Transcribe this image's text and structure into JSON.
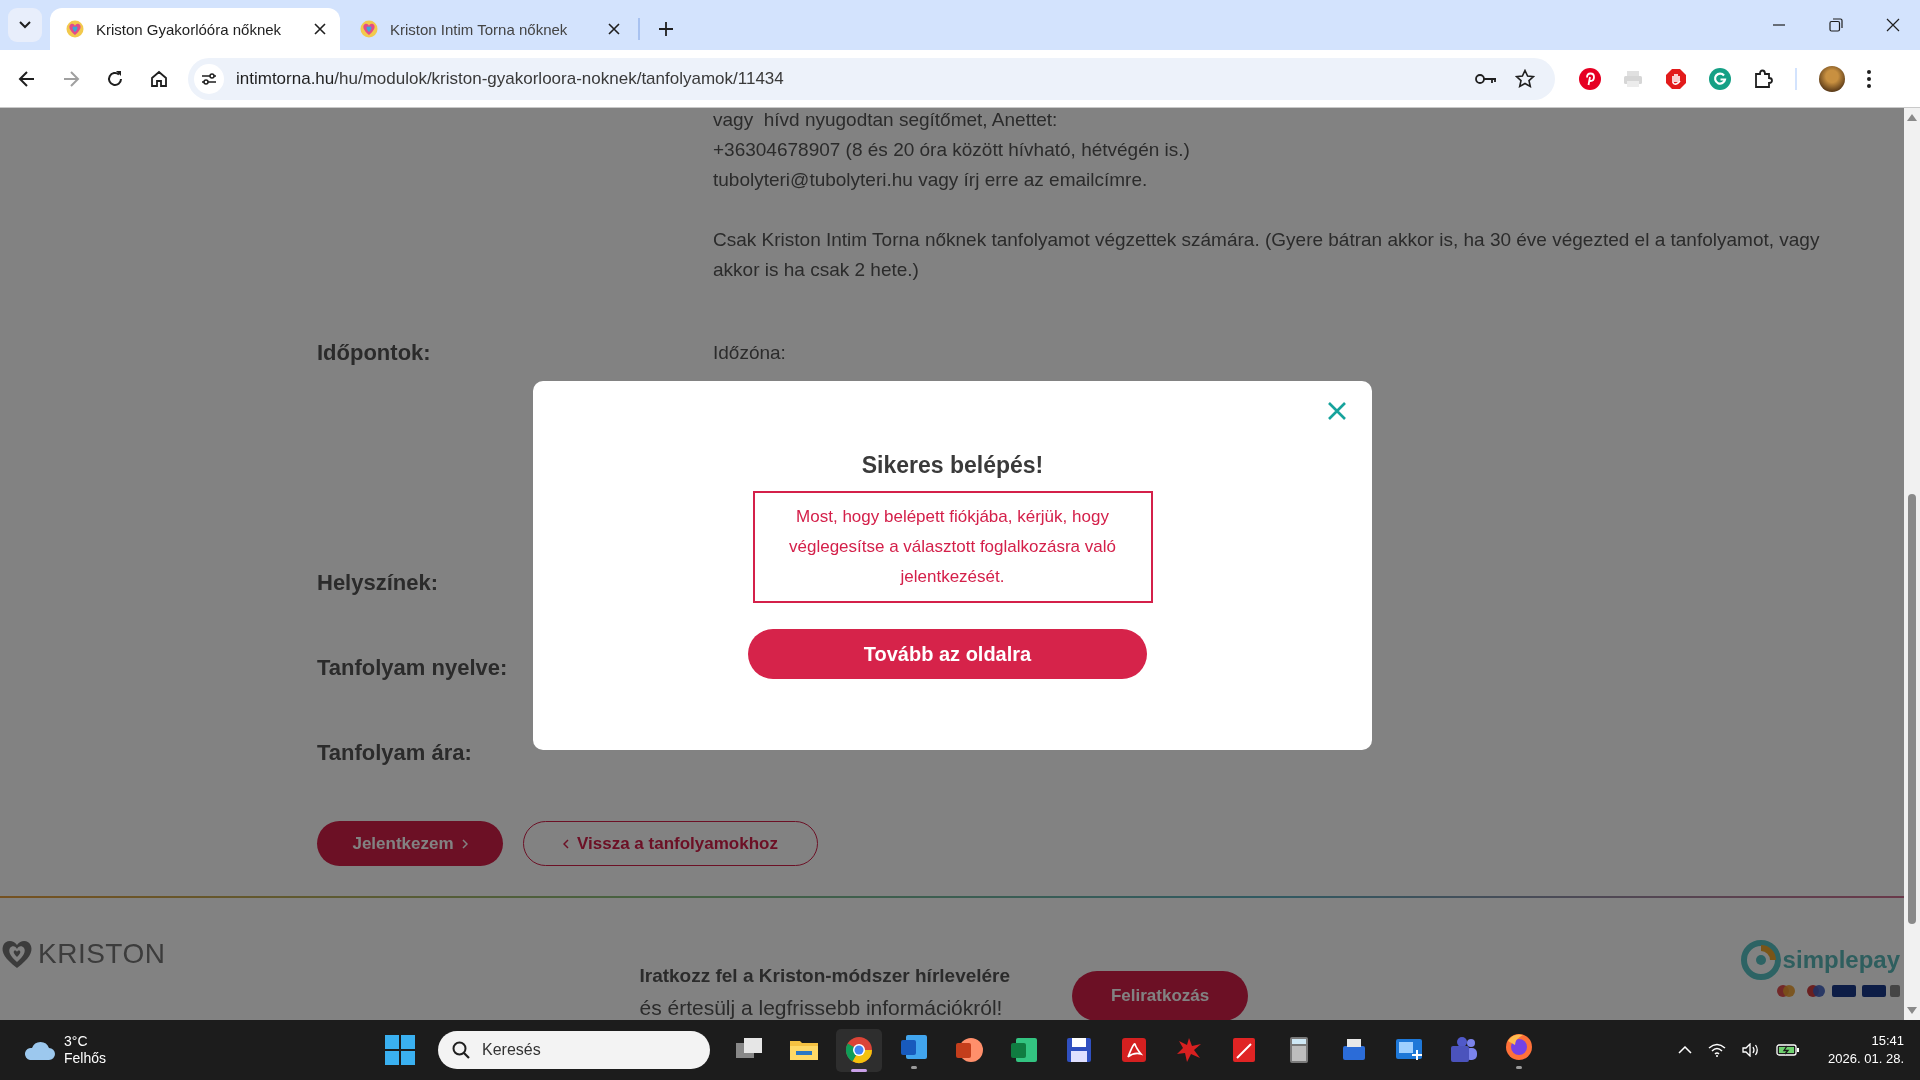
{
  "browser": {
    "tabs": [
      {
        "title": "Kriston Gyakorlóóra nőknek",
        "selected": true
      },
      {
        "title": "Kriston Intim Torna nőknek",
        "selected": false
      }
    ],
    "url": {
      "host": "intimtorna.hu",
      "path": "/hu/modulok/kriston-gyakorloora-noknek/tanfolyamok/11434"
    }
  },
  "page": {
    "contact_lines": [
      "vagy  hívd nyugodtan segítőmet, Anettet:",
      "+36304678907 (8 és 20 óra között hívható, hétvégén is.)",
      "tubolyteri@tubolyteri.hu vagy írj erre az emailcímre."
    ],
    "note": "Csak Kriston Intim Torna nőknek tanfolyamot végzettek számára. (Gyere bátran akkor is, ha 30 éve végezted el a tanfolyamot, vagy akkor is ha csak 2 hete.)",
    "fields": [
      {
        "label": "Időpontok:",
        "values": [
          {
            "text": "Időzóna:",
            "kind": "plain"
          }
        ]
      },
      {
        "label": "Helyszínek:"
      },
      {
        "label": "Tanfolyam nyelve:"
      },
      {
        "label": "Tanfolyam ára:"
      }
    ],
    "actions": [
      {
        "label": "Jelentkezem",
        "kind": "primary"
      },
      {
        "label": "Vissza a tanfolyamokhoz",
        "kind": "secondary"
      }
    ],
    "footer": {
      "logo": "KRISTON",
      "newsletter_title": "Iratkozz fel a Kriston-módszer hírlevelére",
      "newsletter_subtitle": "és értesülj a legfrissebb információkról!",
      "subscribe_button": "Feliratkozás",
      "payment_logo": "simplepay"
    }
  },
  "modal": {
    "title": "Sikeres belépés!",
    "message": "Most, hogy belépett fiókjába, kérjük, hogy véglegesítse a választott foglalkozásra való jelentkezését.",
    "button": "Tovább az oldalra"
  },
  "taskbar": {
    "weather": {
      "temperature": "3°C",
      "condition": "Felhős"
    },
    "search_placeholder": "Keresés",
    "time": "15:41",
    "date": "2026. 01. 28."
  }
}
